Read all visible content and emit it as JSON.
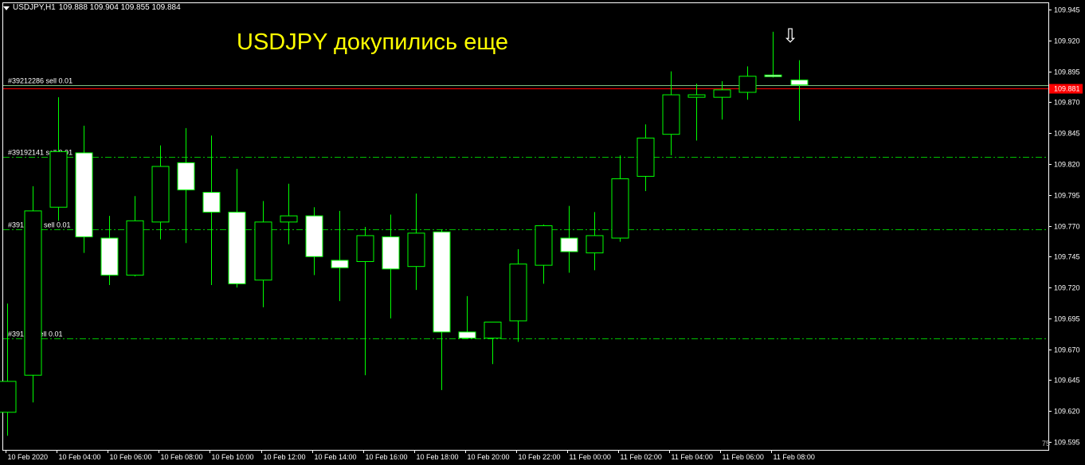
{
  "header": {
    "symbol_label": "USDJPY,H1",
    "ohlc_text": "109.888 109.904 109.855 109.884",
    "menu_icon": "triangle-down-icon"
  },
  "annotation": {
    "text": "USDJPY докупились еще",
    "color": "#ffff00"
  },
  "arrow": {
    "glyph": "⇩",
    "icon": "down-arrow-icon"
  },
  "scale_label": "75",
  "colors": {
    "background": "#000000",
    "frame": "#ffffff",
    "bull_body": "#000000",
    "bear_body": "#ffffff",
    "candle_outline": "#00ff00",
    "order_line": "#00c000",
    "bid_line": "#ff0000",
    "ask_line": "#7fbf7f",
    "price_badge": "#ff0000",
    "axis_text": "#ffffff"
  },
  "chart_data": {
    "type": "candlestick",
    "symbol": "USDJPY",
    "timeframe": "H1",
    "ylim": [
      109.595,
      109.945
    ],
    "y_ticks": [
      "109.945",
      "109.920",
      "109.895",
      "109.870",
      "109.845",
      "109.820",
      "109.795",
      "109.770",
      "109.745",
      "109.720",
      "109.695",
      "109.670",
      "109.645",
      "109.620",
      "109.595"
    ],
    "x_labels": [
      {
        "bar": 0,
        "label": "10 Feb 2020"
      },
      {
        "bar": 2,
        "label": "10 Feb 04:00"
      },
      {
        "bar": 4,
        "label": "10 Feb 06:00"
      },
      {
        "bar": 6,
        "label": "10 Feb 08:00"
      },
      {
        "bar": 8,
        "label": "10 Feb 10:00"
      },
      {
        "bar": 10,
        "label": "10 Feb 12:00"
      },
      {
        "bar": 12,
        "label": "10 Feb 14:00"
      },
      {
        "bar": 14,
        "label": "10 Feb 16:00"
      },
      {
        "bar": 16,
        "label": "10 Feb 18:00"
      },
      {
        "bar": 18,
        "label": "10 Feb 20:00"
      },
      {
        "bar": 20,
        "label": "10 Feb 22:00"
      },
      {
        "bar": 22,
        "label": "11 Feb 00:00"
      },
      {
        "bar": 24,
        "label": "11 Feb 02:00"
      },
      {
        "bar": 26,
        "label": "11 Feb 04:00"
      },
      {
        "bar": 28,
        "label": "11 Feb 06:00"
      },
      {
        "bar": 30,
        "label": "11 Feb 08:00"
      }
    ],
    "candles": [
      {
        "o": 109.619,
        "h": 109.707,
        "l": 109.6,
        "c": 109.644
      },
      {
        "o": 109.649,
        "h": 109.802,
        "l": 109.627,
        "c": 109.782
      },
      {
        "o": 109.785,
        "h": 109.874,
        "l": 109.774,
        "c": 109.83
      },
      {
        "o": 109.829,
        "h": 109.851,
        "l": 109.748,
        "c": 109.761
      },
      {
        "o": 109.76,
        "h": 109.778,
        "l": 109.722,
        "c": 109.73
      },
      {
        "o": 109.73,
        "h": 109.794,
        "l": 109.729,
        "c": 109.774
      },
      {
        "o": 109.773,
        "h": 109.835,
        "l": 109.759,
        "c": 109.818
      },
      {
        "o": 109.821,
        "h": 109.849,
        "l": 109.756,
        "c": 109.799
      },
      {
        "o": 109.797,
        "h": 109.843,
        "l": 109.722,
        "c": 109.781
      },
      {
        "o": 109.781,
        "h": 109.816,
        "l": 109.72,
        "c": 109.723
      },
      {
        "o": 109.726,
        "h": 109.79,
        "l": 109.704,
        "c": 109.773
      },
      {
        "o": 109.773,
        "h": 109.804,
        "l": 109.755,
        "c": 109.778
      },
      {
        "o": 109.778,
        "h": 109.785,
        "l": 109.73,
        "c": 109.745
      },
      {
        "o": 109.742,
        "h": 109.782,
        "l": 109.709,
        "c": 109.736
      },
      {
        "o": 109.741,
        "h": 109.769,
        "l": 109.649,
        "c": 109.762
      },
      {
        "o": 109.761,
        "h": 109.779,
        "l": 109.695,
        "c": 109.735
      },
      {
        "o": 109.737,
        "h": 109.796,
        "l": 109.718,
        "c": 109.764
      },
      {
        "o": 109.765,
        "h": 109.767,
        "l": 109.637,
        "c": 109.684
      },
      {
        "o": 109.684,
        "h": 109.713,
        "l": 109.679,
        "c": 109.679
      },
      {
        "o": 109.679,
        "h": 109.692,
        "l": 109.658,
        "c": 109.692
      },
      {
        "o": 109.693,
        "h": 109.751,
        "l": 109.676,
        "c": 109.739
      },
      {
        "o": 109.738,
        "h": 109.771,
        "l": 109.723,
        "c": 109.77
      },
      {
        "o": 109.76,
        "h": 109.786,
        "l": 109.732,
        "c": 109.749
      },
      {
        "o": 109.748,
        "h": 109.781,
        "l": 109.734,
        "c": 109.762
      },
      {
        "o": 109.76,
        "h": 109.827,
        "l": 109.757,
        "c": 109.808
      },
      {
        "o": 109.81,
        "h": 109.852,
        "l": 109.798,
        "c": 109.841
      },
      {
        "o": 109.844,
        "h": 109.895,
        "l": 109.827,
        "c": 109.876
      },
      {
        "o": 109.874,
        "h": 109.885,
        "l": 109.839,
        "c": 109.876
      },
      {
        "o": 109.874,
        "h": 109.887,
        "l": 109.856,
        "c": 109.88
      },
      {
        "o": 109.878,
        "h": 109.899,
        "l": 109.872,
        "c": 109.891
      },
      {
        "o": 109.892,
        "h": 109.927,
        "l": 109.89,
        "c": 109.891
      },
      {
        "o": 109.888,
        "h": 109.904,
        "l": 109.855,
        "c": 109.884
      }
    ],
    "order_lines": [
      {
        "price": 109.884,
        "label": "#39212286 sell 0.01",
        "style": "solid"
      },
      {
        "price": 109.826,
        "label": "#39192141 sell 0.01",
        "style": "dashdot"
      },
      {
        "price": 109.767,
        "label": "#39163 63 sell 0.01",
        "style": "dashdot"
      },
      {
        "price": 109.679,
        "label": "#391 43 sell 0.01",
        "style": "dashdot"
      }
    ],
    "bid_price": 109.881,
    "bid_label": "109.881"
  }
}
